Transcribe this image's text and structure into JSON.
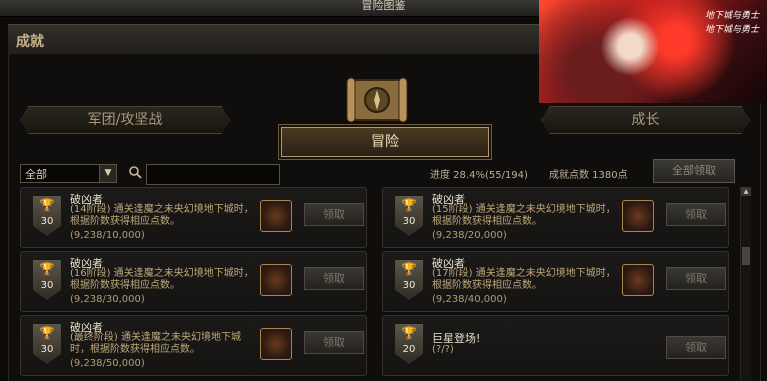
{
  "window": {
    "title": "冒险图鉴"
  },
  "header": {
    "label": "成就"
  },
  "banner": {
    "logo_line1": "地下城与勇士",
    "logo_line2": "地下城与勇士"
  },
  "tabs": [
    {
      "label": "军团/攻坚战",
      "active": false
    },
    {
      "label": "冒险",
      "active": true
    },
    {
      "label": "成长",
      "active": false
    }
  ],
  "filter": {
    "selected": "全部",
    "search_placeholder": ""
  },
  "stats": {
    "progress": "进度 28.4%(55/194)",
    "points": "成就点数 1380点",
    "claim_all_label": "全部领取"
  },
  "achievements": [
    {
      "name": "破凶者",
      "desc": "(14阶段) 通关逢魔之未央幻境地下城时，根据阶数获得相应点数。",
      "progress": "(9,238/10,000)",
      "points": "30",
      "claim": "领取"
    },
    {
      "name": "破凶者",
      "desc": "(15阶段) 通关逢魔之未央幻境地下城时，根据阶数获得相应点数。",
      "progress": "(9,238/20,000)",
      "points": "30",
      "claim": "领取"
    },
    {
      "name": "破凶者",
      "desc": "(16阶段) 通关逢魔之未央幻境地下城时，根据阶数获得相应点数。",
      "progress": "(9,238/30,000)",
      "points": "30",
      "claim": "领取"
    },
    {
      "name": "破凶者",
      "desc": "(17阶段) 通关逢魔之未央幻境地下城时，根据阶数获得相应点数。",
      "progress": "(9,238/40,000)",
      "points": "30",
      "claim": "领取"
    },
    {
      "name": "破凶者",
      "desc": "(最终阶段) 通关逢魔之未央幻境地下城时，根据阶数获得相应点数。",
      "progress": "(9,238/50,000)",
      "points": "30",
      "claim": "领取"
    },
    {
      "name": "巨星登场!",
      "desc": "(?/?)",
      "progress": "",
      "points": "20",
      "claim": "领取"
    }
  ]
}
